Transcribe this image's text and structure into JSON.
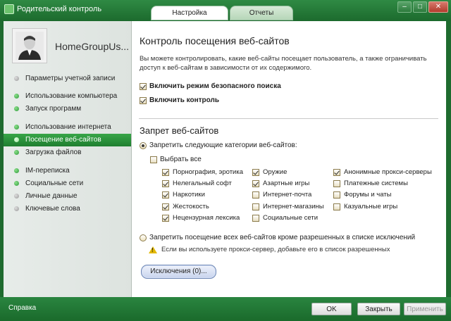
{
  "window": {
    "title": "Родительский контроль",
    "controls": [
      "–",
      "□",
      "✕"
    ]
  },
  "tabs": [
    {
      "label": "Настройка",
      "active": true
    },
    {
      "label": "Отчеты",
      "active": false
    }
  ],
  "sidebar": {
    "username": "HomeGroupUs...",
    "items": [
      {
        "label": "Параметры учетной записи",
        "status": "grey"
      },
      {
        "label": "Использование компьютера",
        "status": "green"
      },
      {
        "label": "Запуск программ",
        "status": "green"
      },
      {
        "label": "Использование интернета",
        "status": "green"
      },
      {
        "label": "Посещение веб-сайтов",
        "status": "green",
        "selected": true
      },
      {
        "label": "Загрузка файлов",
        "status": "green"
      },
      {
        "label": "IM-переписка",
        "status": "green"
      },
      {
        "label": "Социальные сети",
        "status": "green"
      },
      {
        "label": "Личные данные",
        "status": "grey"
      },
      {
        "label": "Ключевые слова",
        "status": "grey"
      }
    ]
  },
  "main": {
    "title": "Контроль посещения веб-сайтов",
    "description": "Вы можете контролировать, какие веб-сайты посещает пользователь, а также ограничивать доступ к веб-сайтам в зависимости от их содержимого.",
    "safe_search": {
      "label": "Включить режим безопасного поиска",
      "checked": true
    },
    "enable_control": {
      "label": "Включить контроль",
      "checked": true
    },
    "block_section_title": "Запрет веб-сайтов",
    "radio_block_categories": {
      "label": "Запретить следующие категории веб-сайтов:",
      "checked": true
    },
    "select_all": {
      "label": "Выбрать все",
      "checked": false
    },
    "categories": [
      [
        {
          "label": "Порнография, эротика",
          "checked": true
        },
        {
          "label": "Нелегальный софт",
          "checked": true
        },
        {
          "label": "Наркотики",
          "checked": true
        },
        {
          "label": "Жестокость",
          "checked": true
        },
        {
          "label": "Нецензурная лексика",
          "checked": true
        }
      ],
      [
        {
          "label": "Оружие",
          "checked": true
        },
        {
          "label": "Азартные игры",
          "checked": true
        },
        {
          "label": "Интернет-почта",
          "checked": false
        },
        {
          "label": "Интернет-магазины",
          "checked": false
        },
        {
          "label": "Социальные сети",
          "checked": false
        }
      ],
      [
        {
          "label": "Анонимные прокси-серверы",
          "checked": true
        },
        {
          "label": "Платежные системы",
          "checked": false
        },
        {
          "label": "Форумы и чаты",
          "checked": false
        },
        {
          "label": "Казуальные игры",
          "checked": false
        }
      ]
    ],
    "radio_block_all": {
      "label": "Запретить посещение всех веб-сайтов кроме разрешенных в списке исключений",
      "checked": false
    },
    "proxy_note": "Если вы используете прокси-сервер, добавьте его в список разрешенных",
    "exceptions_button": "Исключения (0)..."
  },
  "footer": {
    "help": "Справка",
    "ok": "OK",
    "close": "Закрыть",
    "apply": "Применить"
  }
}
